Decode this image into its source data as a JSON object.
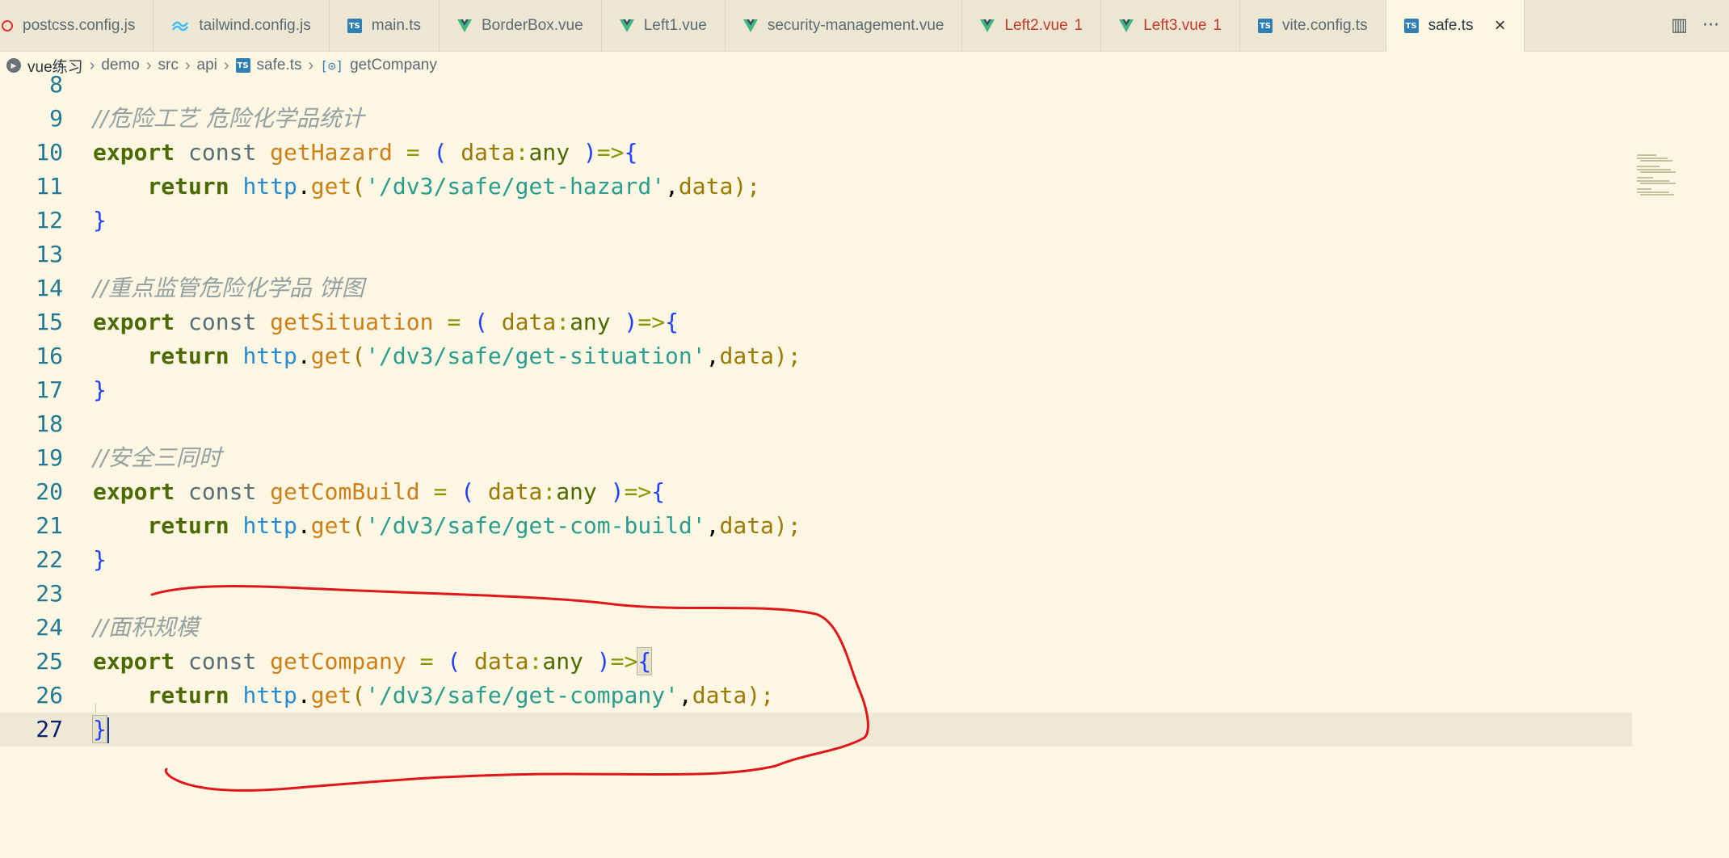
{
  "tabs": [
    {
      "label": "postcss.config.js",
      "icon": "postcss-icon",
      "modified": false,
      "active": false,
      "badge": ""
    },
    {
      "label": "tailwind.config.js",
      "icon": "tailwind-icon",
      "modified": false,
      "active": false,
      "badge": ""
    },
    {
      "label": "main.ts",
      "icon": "typescript-icon",
      "modified": false,
      "active": false,
      "badge": ""
    },
    {
      "label": "BorderBox.vue",
      "icon": "vue-icon",
      "modified": false,
      "active": false,
      "badge": ""
    },
    {
      "label": "Left1.vue",
      "icon": "vue-icon",
      "modified": false,
      "active": false,
      "badge": ""
    },
    {
      "label": "security-management.vue",
      "icon": "vue-icon",
      "modified": false,
      "active": false,
      "badge": ""
    },
    {
      "label": "Left2.vue",
      "icon": "vue-icon",
      "modified": true,
      "active": false,
      "badge": "1"
    },
    {
      "label": "Left3.vue",
      "icon": "vue-icon",
      "modified": true,
      "active": false,
      "badge": "1"
    },
    {
      "label": "vite.config.ts",
      "icon": "typescript-icon",
      "modified": false,
      "active": false,
      "badge": ""
    },
    {
      "label": "safe.ts",
      "icon": "typescript-icon",
      "modified": false,
      "active": true,
      "badge": ""
    }
  ],
  "tab_actions": {
    "close": "×",
    "split": "▥",
    "more": "···"
  },
  "icons": {
    "ts_label": "TS"
  },
  "breadcrumb": [
    "vue练习",
    "demo",
    "src",
    "api",
    "safe.ts",
    "getCompany"
  ],
  "editor": {
    "first_line": 8,
    "current_line": 27,
    "lines": [
      {
        "n": "8",
        "tokens": []
      },
      {
        "n": "9",
        "tokens": [
          {
            "t": "//危险工艺 危险化学品统计",
            "c": "cm"
          }
        ]
      },
      {
        "n": "10",
        "tokens": [
          {
            "t": "export",
            "c": "kw"
          },
          {
            "t": " "
          },
          {
            "t": "const",
            "c": "kw2"
          },
          {
            "t": " "
          },
          {
            "t": "getHazard",
            "c": "fn"
          },
          {
            "t": " "
          },
          {
            "t": "=",
            "c": "op"
          },
          {
            "t": " "
          },
          {
            "t": "(",
            "c": "pn"
          },
          {
            "t": " "
          },
          {
            "t": "data",
            "c": "prm"
          },
          {
            "t": ":",
            "c": "op"
          },
          {
            "t": "any",
            "c": "typ"
          },
          {
            "t": " "
          },
          {
            "t": ")",
            "c": "pn"
          },
          {
            "t": "=>",
            "c": "op"
          },
          {
            "t": "{",
            "c": "pn"
          }
        ]
      },
      {
        "n": "11",
        "tokens": [
          {
            "t": "    "
          },
          {
            "t": "return",
            "c": "kw"
          },
          {
            "t": " "
          },
          {
            "t": "http",
            "c": "id"
          },
          {
            "t": "."
          },
          {
            "t": "get",
            "c": "fn"
          },
          {
            "t": "(",
            "c": "prm"
          },
          {
            "t": "'/dv3/safe/get-hazard'",
            "c": "str"
          },
          {
            "t": ","
          },
          {
            "t": "data",
            "c": "prm"
          },
          {
            "t": ");",
            "c": "prm"
          }
        ]
      },
      {
        "n": "12",
        "tokens": [
          {
            "t": "}",
            "c": "pn"
          }
        ]
      },
      {
        "n": "13",
        "tokens": []
      },
      {
        "n": "14",
        "tokens": [
          {
            "t": "//重点监管危险化学品 饼图",
            "c": "cm"
          }
        ]
      },
      {
        "n": "15",
        "tokens": [
          {
            "t": "export",
            "c": "kw"
          },
          {
            "t": " "
          },
          {
            "t": "const",
            "c": "kw2"
          },
          {
            "t": " "
          },
          {
            "t": "getSituation",
            "c": "fn"
          },
          {
            "t": " "
          },
          {
            "t": "=",
            "c": "op"
          },
          {
            "t": " "
          },
          {
            "t": "(",
            "c": "pn"
          },
          {
            "t": " "
          },
          {
            "t": "data",
            "c": "prm"
          },
          {
            "t": ":",
            "c": "op"
          },
          {
            "t": "any",
            "c": "typ"
          },
          {
            "t": " "
          },
          {
            "t": ")",
            "c": "pn"
          },
          {
            "t": "=>",
            "c": "op"
          },
          {
            "t": "{",
            "c": "pn"
          }
        ]
      },
      {
        "n": "16",
        "tokens": [
          {
            "t": "    "
          },
          {
            "t": "return",
            "c": "kw"
          },
          {
            "t": " "
          },
          {
            "t": "http",
            "c": "id"
          },
          {
            "t": "."
          },
          {
            "t": "get",
            "c": "fn"
          },
          {
            "t": "(",
            "c": "prm"
          },
          {
            "t": "'/dv3/safe/get-situation'",
            "c": "str"
          },
          {
            "t": ","
          },
          {
            "t": "data",
            "c": "prm"
          },
          {
            "t": ");",
            "c": "prm"
          }
        ]
      },
      {
        "n": "17",
        "tokens": [
          {
            "t": "}",
            "c": "pn"
          }
        ]
      },
      {
        "n": "18",
        "tokens": []
      },
      {
        "n": "19",
        "tokens": [
          {
            "t": "//安全三同时",
            "c": "cm"
          }
        ]
      },
      {
        "n": "20",
        "tokens": [
          {
            "t": "export",
            "c": "kw"
          },
          {
            "t": " "
          },
          {
            "t": "const",
            "c": "kw2"
          },
          {
            "t": " "
          },
          {
            "t": "getComBuild",
            "c": "fn"
          },
          {
            "t": " "
          },
          {
            "t": "=",
            "c": "op"
          },
          {
            "t": " "
          },
          {
            "t": "(",
            "c": "pn"
          },
          {
            "t": " "
          },
          {
            "t": "data",
            "c": "prm"
          },
          {
            "t": ":",
            "c": "op"
          },
          {
            "t": "any",
            "c": "typ"
          },
          {
            "t": " "
          },
          {
            "t": ")",
            "c": "pn"
          },
          {
            "t": "=>",
            "c": "op"
          },
          {
            "t": "{",
            "c": "pn"
          }
        ]
      },
      {
        "n": "21",
        "tokens": [
          {
            "t": "    "
          },
          {
            "t": "return",
            "c": "kw"
          },
          {
            "t": " "
          },
          {
            "t": "http",
            "c": "id"
          },
          {
            "t": "."
          },
          {
            "t": "get",
            "c": "fn"
          },
          {
            "t": "(",
            "c": "prm"
          },
          {
            "t": "'/dv3/safe/get-com-build'",
            "c": "str"
          },
          {
            "t": ","
          },
          {
            "t": "data",
            "c": "prm"
          },
          {
            "t": ");",
            "c": "prm"
          }
        ]
      },
      {
        "n": "22",
        "tokens": [
          {
            "t": "}",
            "c": "pn"
          }
        ]
      },
      {
        "n": "23",
        "tokens": []
      },
      {
        "n": "24",
        "tokens": [
          {
            "t": "//面积规模",
            "c": "cm"
          }
        ]
      },
      {
        "n": "25",
        "tokens": [
          {
            "t": "export",
            "c": "kw"
          },
          {
            "t": " "
          },
          {
            "t": "const",
            "c": "kw2"
          },
          {
            "t": " "
          },
          {
            "t": "getCompany",
            "c": "fn"
          },
          {
            "t": " "
          },
          {
            "t": "=",
            "c": "op"
          },
          {
            "t": " "
          },
          {
            "t": "(",
            "c": "pn"
          },
          {
            "t": " "
          },
          {
            "t": "data",
            "c": "prm"
          },
          {
            "t": ":",
            "c": "op"
          },
          {
            "t": "any",
            "c": "typ"
          },
          {
            "t": " "
          },
          {
            "t": ")",
            "c": "pn"
          },
          {
            "t": "=>",
            "c": "op"
          },
          {
            "t": "{",
            "c": "pn brace-hl"
          }
        ]
      },
      {
        "n": "26",
        "tokens": [
          {
            "t": "    "
          },
          {
            "t": "return",
            "c": "kw"
          },
          {
            "t": " "
          },
          {
            "t": "http",
            "c": "id"
          },
          {
            "t": "."
          },
          {
            "t": "get",
            "c": "fn"
          },
          {
            "t": "(",
            "c": "prm"
          },
          {
            "t": "'/dv3/safe/get-company'",
            "c": "str"
          },
          {
            "t": ","
          },
          {
            "t": "data",
            "c": "prm"
          },
          {
            "t": ");",
            "c": "prm"
          }
        ]
      },
      {
        "n": "27",
        "tokens": [
          {
            "t": "}",
            "c": "pn brace-hl"
          }
        ],
        "cursor": true
      }
    ]
  },
  "colors": {
    "annotation": "#e0161b",
    "background": "#fdf6e3",
    "current_line": "#eee8d5"
  }
}
